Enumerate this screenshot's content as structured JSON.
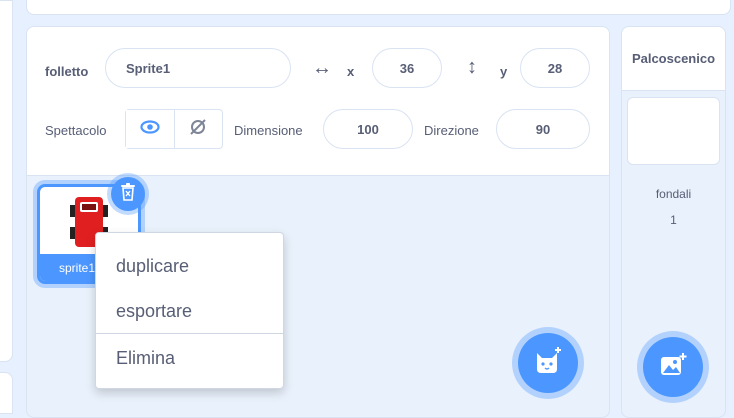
{
  "sprite_info": {
    "sprite_label": "folletto",
    "sprite_name": "Sprite1",
    "x_label": "x",
    "x_value": "36",
    "y_label": "y",
    "y_value": "28",
    "show_label": "Spettacolo",
    "size_label": "Dimensione",
    "size_value": "100",
    "direction_label": "Direzione",
    "direction_value": "90"
  },
  "sprite_tile": {
    "label": "sprite1",
    "icon": "red-car-costume-icon"
  },
  "context_menu": {
    "items": [
      {
        "label": "duplicare"
      },
      {
        "label": "esportare"
      },
      {
        "label": "Elimina"
      }
    ]
  },
  "stage": {
    "header": "Palcoscenico",
    "backdrops_label": "fondali",
    "backdrops_count": "1"
  },
  "icons": {
    "delete": "trash-icon",
    "choose_sprite": "cat-add-icon",
    "choose_backdrop": "image-add-icon",
    "show": "eye-icon",
    "hide": "eye-slash-icon"
  },
  "colors": {
    "accent": "#4c97ff",
    "text": "#575e75",
    "pane_bg": "#e9f1fc",
    "costume_red": "#e02020"
  }
}
